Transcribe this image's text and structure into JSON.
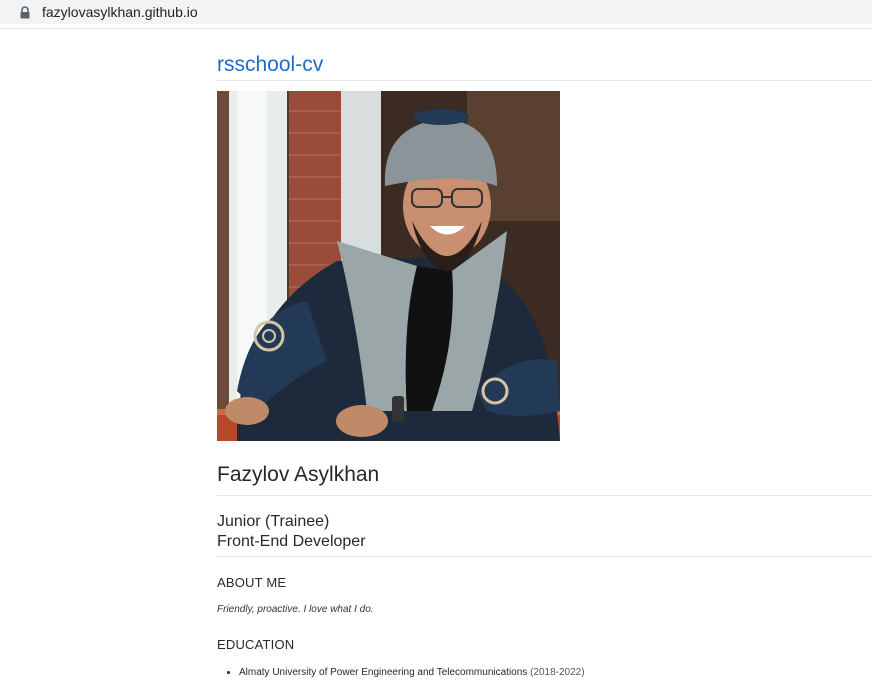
{
  "browser": {
    "url": "fazylovasylkhan.github.io",
    "lock_icon": "lock-icon"
  },
  "site": {
    "title": "rsschool-cv"
  },
  "profile": {
    "photo_icon": "profile-photo",
    "name": "Fazylov Asylkhan",
    "role_line1": "Junior (Trainee)",
    "role_line2": "Front-End Developer"
  },
  "about": {
    "heading": "ABOUT ME",
    "text": "Friendly, proactive. I love what I do."
  },
  "education": {
    "heading": "EDUCATION",
    "items": [
      {
        "school": "Almaty University of Power Engineering and Telecommunications",
        "years": "(2018-2022)"
      }
    ]
  },
  "colors": {
    "link": "#1f6cc6",
    "text": "#24292e",
    "divider": "#e6e6e6"
  }
}
